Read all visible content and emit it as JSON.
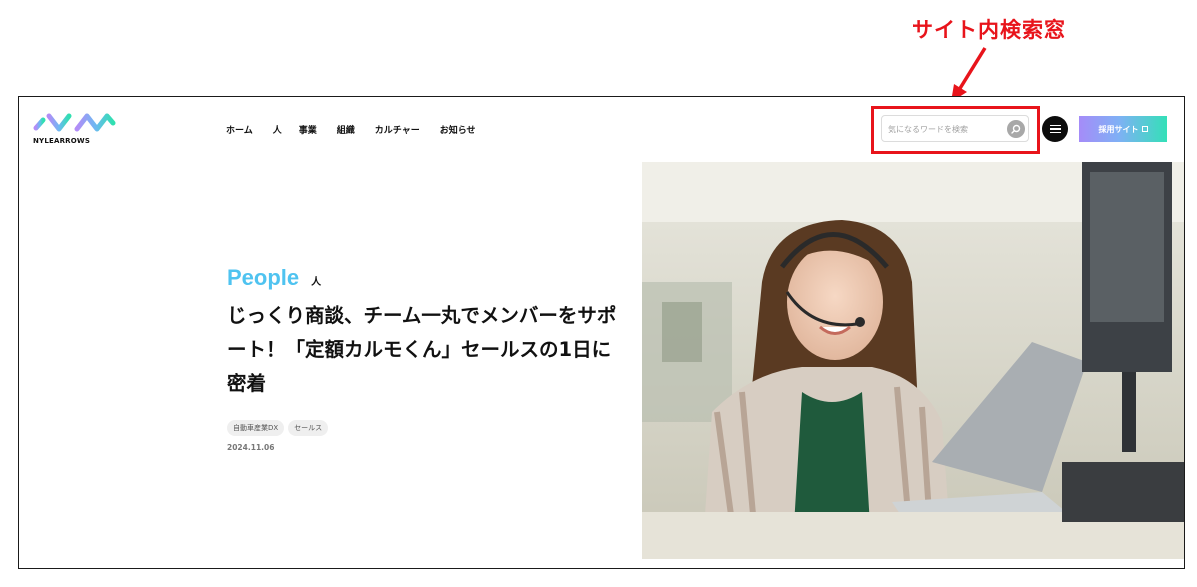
{
  "annotation": {
    "label": "サイト内検索窓",
    "color": "#e8141b"
  },
  "header": {
    "logo_text": "NYLEARROWS",
    "nav": [
      "ホーム",
      "人",
      "事業",
      "組織",
      "カルチャー",
      "お知らせ"
    ],
    "search": {
      "placeholder": "気になるワードを検索"
    },
    "recruit_button": "採用サイト"
  },
  "article": {
    "category_en": "People",
    "category_ja": "人",
    "title": "じっくり商談、チーム一丸でメンバーをサポート！「定額カルモくん」セールスの1日に密着",
    "tags": [
      "自動車産業DX",
      "セールス"
    ],
    "date": "2024.11.06"
  },
  "colors": {
    "accent_blue": "#4fc3f0",
    "recruit_gradient": [
      "#a58cf8",
      "#34e0b8"
    ]
  }
}
